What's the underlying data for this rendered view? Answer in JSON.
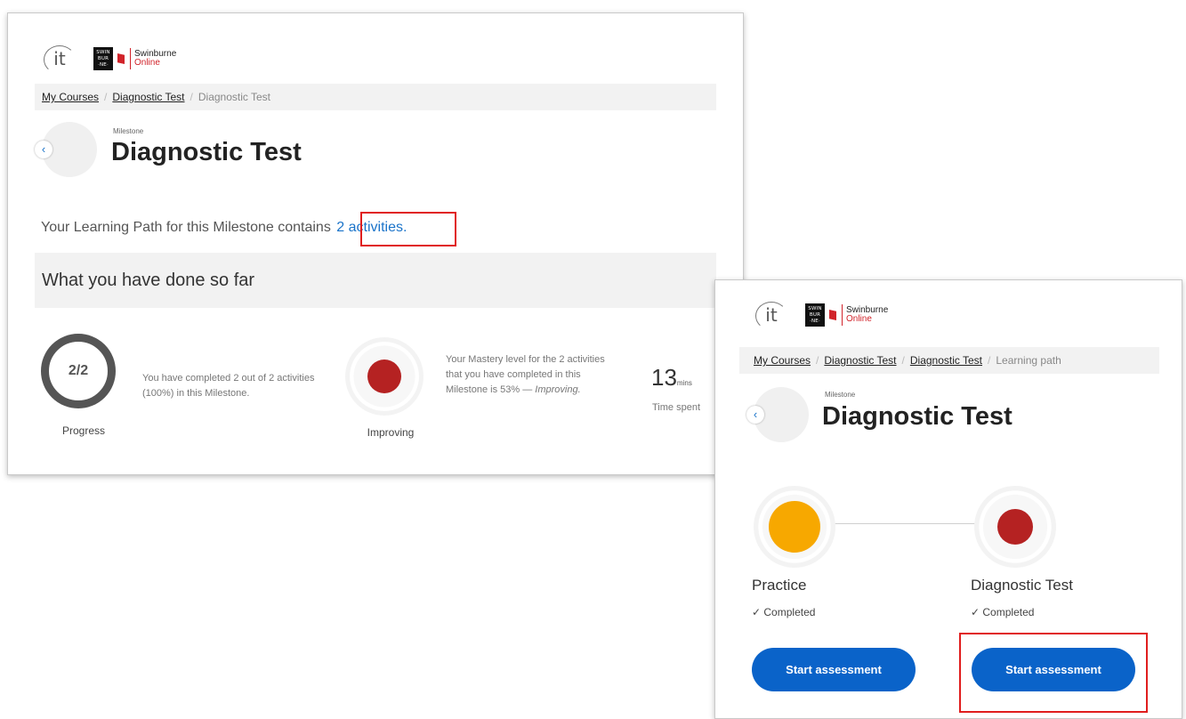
{
  "colors": {
    "accent": "#0a63c9",
    "link": "#1a73c9",
    "brand_red": "#d1232a",
    "highlight_box": "#e01e1e",
    "mastery_red": "#b52222",
    "mastery_amber": "#f7a800"
  },
  "logos": {
    "it": "it",
    "swin": [
      "SWIN",
      "BUR",
      "·NE·"
    ],
    "swinburne": "Swinburne",
    "online": "Online"
  },
  "panel_a": {
    "breadcrumb": {
      "my_courses": "My Courses",
      "diagnostic": "Diagnostic Test",
      "current": "Diagnostic Test"
    },
    "milestone_label": "Milestone",
    "title": "Diagnostic Test",
    "learning_path_text": "Your Learning Path for this Milestone contains",
    "activities_link": "2 activities.",
    "done_heading": "What you have done so far",
    "progress": {
      "value": "2/2",
      "label": "Progress",
      "text": "You have completed 2 out of 2 activities (100%) in this Milestone."
    },
    "mastery": {
      "label": "Improving",
      "text_prefix": "Your Mastery level for the 2 activities that you have completed in this Milestone is 53% —",
      "text_level": "Improving."
    },
    "time": {
      "value": "13",
      "unit": "mins",
      "label": "Time spent"
    }
  },
  "panel_b": {
    "breadcrumb": {
      "my_courses": "My Courses",
      "diagnostic1": "Diagnostic Test",
      "diagnostic2": "Diagnostic Test",
      "current": "Learning path"
    },
    "milestone_label": "Milestone",
    "title": "Diagnostic Test",
    "activities": [
      {
        "name": "Practice",
        "status": "✓ Completed",
        "button": "Start assessment",
        "color": "#f7a800"
      },
      {
        "name": "Diagnostic Test",
        "status": "✓ Completed",
        "button": "Start assessment",
        "color": "#b52222"
      }
    ]
  }
}
